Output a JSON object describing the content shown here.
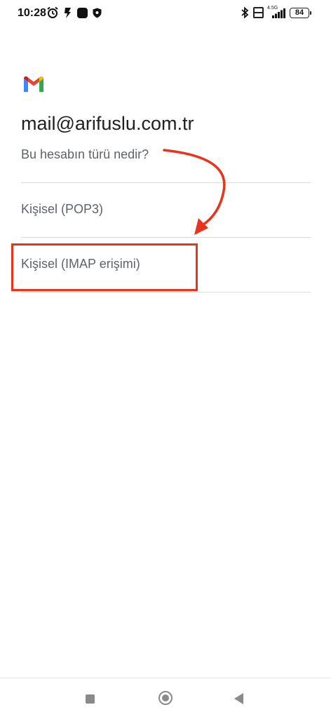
{
  "status_bar": {
    "time": "10:28",
    "network_label": "4.5G",
    "battery": "84",
    "icons": [
      "alarm-icon",
      "app-icon",
      "app-square-icon",
      "shield-icon",
      "bluetooth-icon",
      "volte-icon",
      "signal-icon",
      "battery-icon"
    ]
  },
  "account": {
    "email": "mail@arifuslu.com.tr",
    "question": "Bu hesabın türü nedir?"
  },
  "options": [
    {
      "label": "Kişisel (POP3)"
    },
    {
      "label": "Kişisel (IMAP erişimi)"
    }
  ],
  "annotation": {
    "color": "#e8341c",
    "highlighted_option": "Kişisel (IMAP erişimi)"
  },
  "nav_bar": {
    "icons": [
      "recents-icon",
      "home-icon",
      "back-icon"
    ]
  },
  "colors": {
    "text_primary": "#202124",
    "text_secondary": "#5f6368",
    "divider": "#dadce0"
  }
}
